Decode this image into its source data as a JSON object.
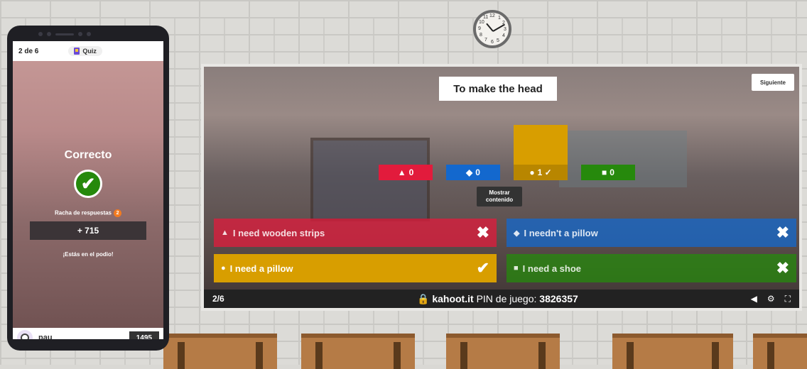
{
  "clock": {
    "numbers": [
      "12",
      "1",
      "2",
      "3",
      "4",
      "5",
      "6",
      "7",
      "8",
      "9",
      "10",
      "11"
    ]
  },
  "phone": {
    "progress": "2 de 6",
    "quiz_label": "Quiz",
    "result": "Correcto",
    "streak_label": "Racha de respuestas",
    "streak_count": "2",
    "points": "+ 715",
    "podium_msg": "¡Estás en el podio!",
    "player_name": "pau",
    "player_score": "1495"
  },
  "game": {
    "question": "To make the head",
    "next_label": "Siguiente",
    "stats": [
      {
        "shape": "▲",
        "value": "0",
        "color": "#e21b3c"
      },
      {
        "shape": "◆",
        "value": "0",
        "color": "#1368ce"
      },
      {
        "shape": "●",
        "value": "1 ✓",
        "color": "#d89e00"
      },
      {
        "shape": "■",
        "value": "0",
        "color": "#26890c"
      }
    ],
    "show_content_label": "Mostrar contenido",
    "answers": [
      {
        "shape": "▲",
        "text": "I need wooden strips",
        "mark": "✖",
        "color": "#e21b3c",
        "correct": false
      },
      {
        "shape": "◆",
        "text": "I needn't a pillow",
        "mark": "✖",
        "color": "#1368ce",
        "correct": false
      },
      {
        "shape": "●",
        "text": "I need a pillow",
        "mark": "✔",
        "color": "#d89e00",
        "correct": true
      },
      {
        "shape": "■",
        "text": "I need a shoe",
        "mark": "✖",
        "color": "#26890c",
        "correct": false
      }
    ],
    "footer": {
      "count": "2/6",
      "site": "kahoot.it",
      "pin_label": "PIN de juego:",
      "pin": "3826357"
    }
  }
}
